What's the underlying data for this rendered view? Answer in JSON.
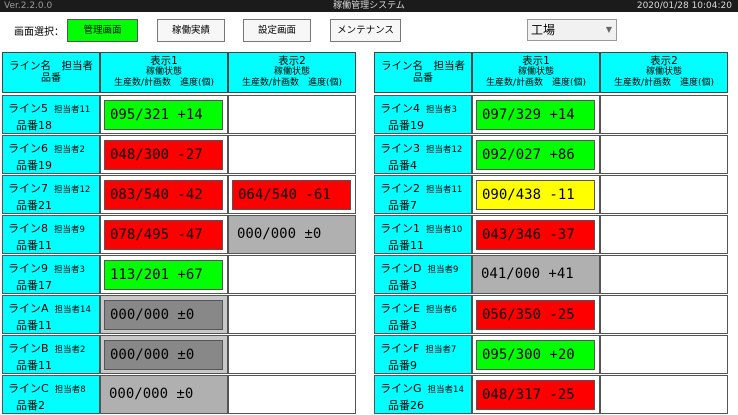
{
  "window": {
    "version": "Ver.2.2.0.0",
    "title": "稼働管理システム",
    "datetime": "2020/01/28 10:04:20"
  },
  "toolbar": {
    "screen_select_label": "画面選択：",
    "buttons": [
      "管理画面",
      "稼働実績",
      "設定画面",
      "メンテナンス"
    ],
    "factory": "工場"
  },
  "colors": {
    "ok": "#00ff00",
    "ng": "#ff0000",
    "warn": "#ffff00",
    "idle": "#b0b0b0",
    "stop": "#888888",
    "header": "#00ffff"
  },
  "headers": {
    "name": {
      "l1": "ライン名　担当者",
      "l2": "品番"
    },
    "display1": {
      "l1": "表示1",
      "l2": "稼働状態",
      "l3": "生産数/計画数　進度(個)"
    },
    "display2": {
      "l1": "表示2",
      "l2": "稼働状態",
      "l3": "生産数/計画数　進度(個)"
    }
  },
  "left_rows": [
    {
      "line": "ライン5",
      "manager": "担当者11",
      "product": "品番18",
      "d1": {
        "text": "095/321 +14",
        "status": "ok"
      },
      "d2": {
        "text": "",
        "status": "empty"
      }
    },
    {
      "line": "ライン6",
      "manager": "担当者2",
      "product": "品番19",
      "d1": {
        "text": "048/300 -27",
        "status": "ng"
      },
      "d2": {
        "text": "",
        "status": "empty"
      }
    },
    {
      "line": "ライン7",
      "manager": "担当者12",
      "product": "品番21",
      "d1": {
        "text": "083/540 -42",
        "status": "ng"
      },
      "d2": {
        "text": "064/540 -61",
        "status": "ng"
      }
    },
    {
      "line": "ライン8",
      "manager": "担当者9",
      "product": "品番11",
      "d1": {
        "text": "078/495 -47",
        "status": "ng"
      },
      "d2": {
        "text": "000/000 ±0",
        "status": "idle"
      }
    },
    {
      "line": "ライン9",
      "manager": "担当者3",
      "product": "品番17",
      "d1": {
        "text": "113/201 +67",
        "status": "ok"
      },
      "d2": {
        "text": "",
        "status": "empty"
      }
    },
    {
      "line": "ラインA",
      "manager": "担当者14",
      "product": "品番11",
      "d1": {
        "text": "000/000 ±0",
        "status": "stop"
      },
      "d2": {
        "text": "",
        "status": "empty"
      }
    },
    {
      "line": "ラインB",
      "manager": "担当者2",
      "product": "品番11",
      "d1": {
        "text": "000/000 ±0",
        "status": "stop"
      },
      "d2": {
        "text": "",
        "status": "empty"
      }
    },
    {
      "line": "ラインC",
      "manager": "担当者8",
      "product": "品番2",
      "d1": {
        "text": "000/000 ±0",
        "status": "idle"
      },
      "d2": {
        "text": "",
        "status": "empty"
      }
    }
  ],
  "right_rows": [
    {
      "line": "ライン4",
      "manager": "担当者3",
      "product": "品番19",
      "d1": {
        "text": "097/329 +14",
        "status": "ok"
      },
      "d2": {
        "text": "",
        "status": "empty"
      }
    },
    {
      "line": "ライン3",
      "manager": "担当者12",
      "product": "品番4",
      "d1": {
        "text": "092/027 +86",
        "status": "ok"
      },
      "d2": {
        "text": "",
        "status": "empty"
      }
    },
    {
      "line": "ライン2",
      "manager": "担当者11",
      "product": "品番7",
      "d1": {
        "text": "090/438 -11",
        "status": "warn"
      },
      "d2": {
        "text": "",
        "status": "empty"
      }
    },
    {
      "line": "ライン1",
      "manager": "担当者10",
      "product": "品番11",
      "d1": {
        "text": "043/346 -37",
        "status": "ng"
      },
      "d2": {
        "text": "",
        "status": "empty"
      }
    },
    {
      "line": "ラインD",
      "manager": "担当者9",
      "product": "品番3",
      "d1": {
        "text": "041/000 +41",
        "status": "idle"
      },
      "d2": {
        "text": "",
        "status": "empty"
      }
    },
    {
      "line": "ラインE",
      "manager": "担当者6",
      "product": "品番3",
      "d1": {
        "text": "056/350 -25",
        "status": "ng"
      },
      "d2": {
        "text": "",
        "status": "empty"
      }
    },
    {
      "line": "ラインF",
      "manager": "担当者7",
      "product": "品番9",
      "d1": {
        "text": "095/300 +20",
        "status": "ok"
      },
      "d2": {
        "text": "",
        "status": "empty"
      }
    },
    {
      "line": "ラインG",
      "manager": "担当者14",
      "product": "品番26",
      "d1": {
        "text": "048/317 -25",
        "status": "ng"
      },
      "d2": {
        "text": "",
        "status": "empty"
      }
    }
  ]
}
